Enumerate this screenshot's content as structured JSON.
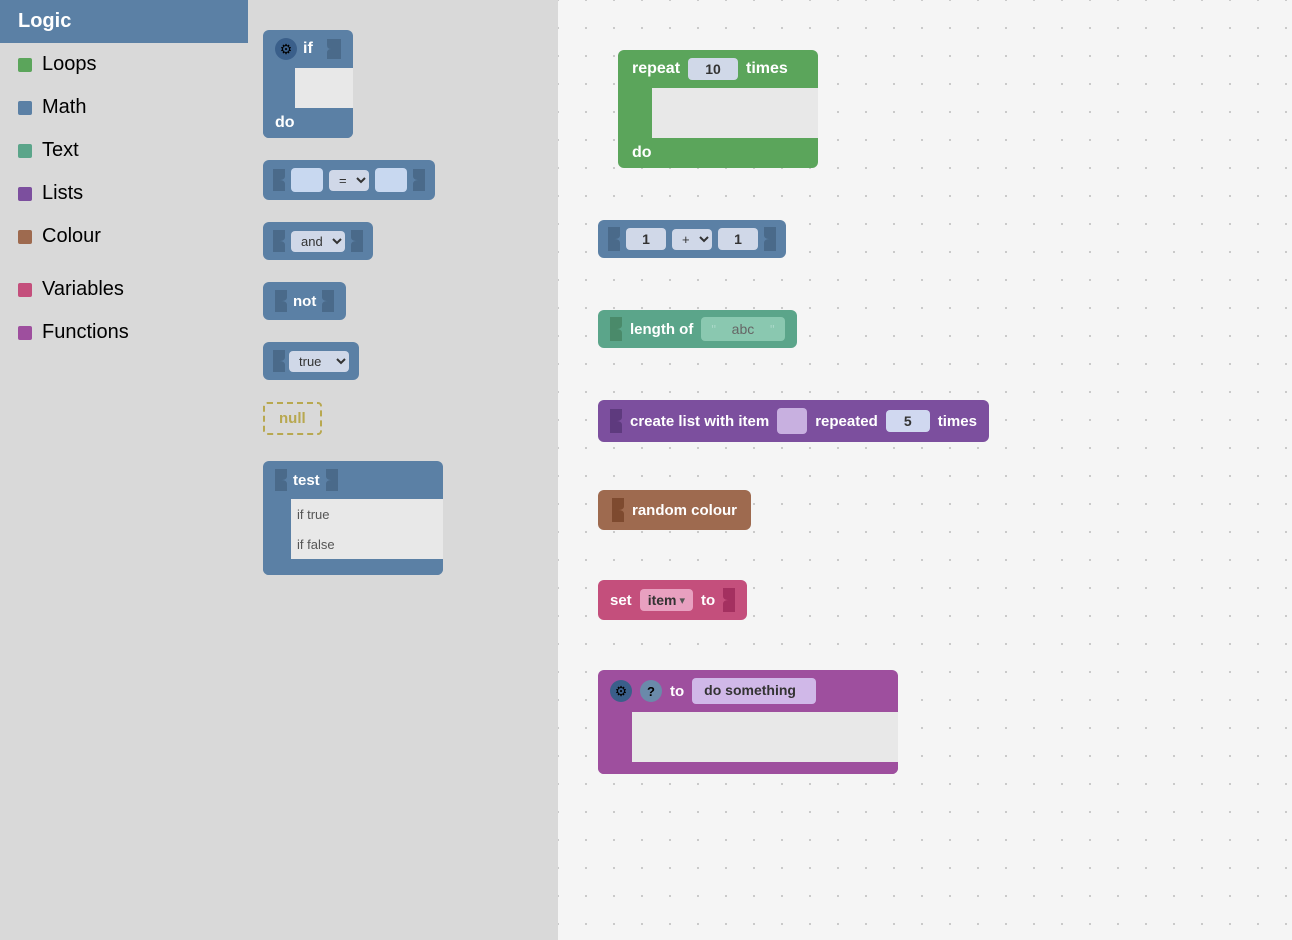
{
  "sidebar": {
    "items": [
      {
        "id": "logic",
        "label": "Logic",
        "color": null,
        "active": true
      },
      {
        "id": "loops",
        "label": "Loops",
        "color": "#5ba55b"
      },
      {
        "id": "math",
        "label": "Math",
        "color": "#5b80a5"
      },
      {
        "id": "text",
        "label": "Text",
        "color": "#5ba58a"
      },
      {
        "id": "lists",
        "label": "Lists",
        "color": "#7c4f9e"
      },
      {
        "id": "colour",
        "label": "Colour",
        "color": "#9e6a4f"
      },
      {
        "id": "sep",
        "label": "",
        "color": null
      },
      {
        "id": "variables",
        "label": "Variables",
        "color": "#c44f7c"
      },
      {
        "id": "functions",
        "label": "Functions",
        "color": "#9e4f9e"
      }
    ]
  },
  "blocks_palette": {
    "blocks": [
      {
        "id": "if-block",
        "type": "c-block-blue",
        "top": "if",
        "bottom": "do"
      },
      {
        "id": "equals-block",
        "type": "inline-blue",
        "label": "="
      },
      {
        "id": "and-block",
        "type": "inline-blue",
        "label": "and"
      },
      {
        "id": "not-block",
        "type": "inline-blue",
        "label": "not"
      },
      {
        "id": "true-block",
        "type": "inline-blue",
        "label": "true"
      },
      {
        "id": "null-block",
        "type": "null-block",
        "label": "null"
      },
      {
        "id": "ternary-block",
        "type": "c-block-blue-ternary",
        "label": "test / if true / if false"
      }
    ]
  },
  "canvas_blocks": {
    "repeat_block": {
      "label_before": "repeat",
      "value": "10",
      "label_after": "times",
      "do_label": "do"
    },
    "math_block": {
      "val1": "1",
      "op": "+",
      "val2": "1"
    },
    "text_block": {
      "label": "length of",
      "text_value": "abc"
    },
    "list_block": {
      "label": "create list with item",
      "repeated_label": "repeated",
      "times_value": "5",
      "times_label": "times"
    },
    "colour_block": {
      "label": "random colour"
    },
    "variable_block": {
      "set_label": "set",
      "var_name": "item",
      "to_label": "to"
    },
    "function_block": {
      "to_label": "to",
      "func_name": "do something"
    }
  },
  "icons": {
    "gear": "⚙",
    "question": "?",
    "dropdown_arrow": "▾"
  }
}
